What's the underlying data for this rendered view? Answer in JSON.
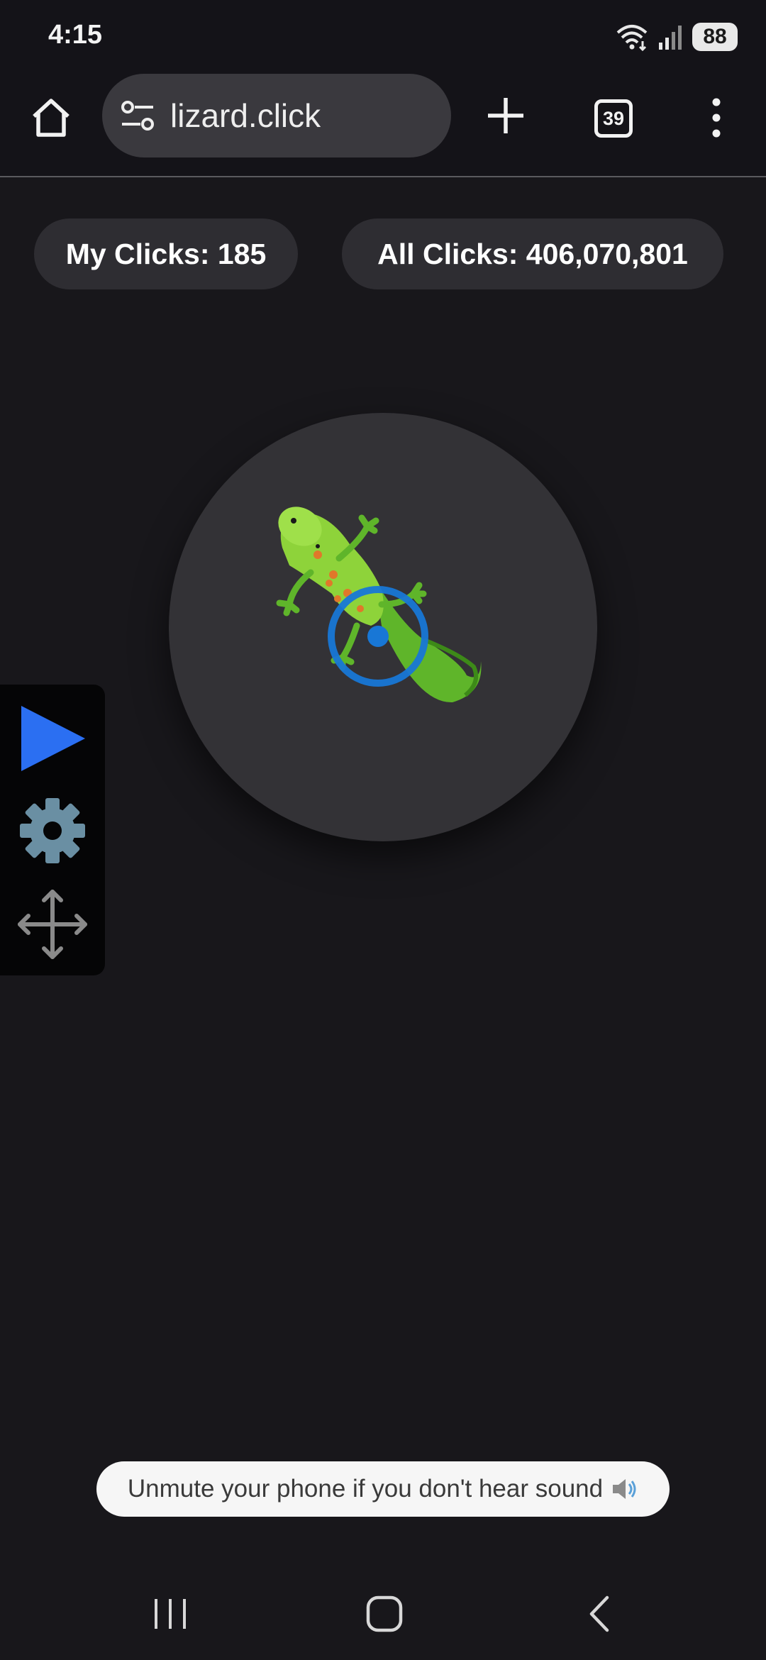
{
  "status_bar": {
    "time": "4:15",
    "battery": "88"
  },
  "browser": {
    "url": "lizard.click",
    "tab_count": "39"
  },
  "counters": {
    "my_clicks": "My Clicks: 185",
    "all_clicks": "All Clicks: 406,070,801"
  },
  "main": {
    "button_icon": "lizard-icon",
    "tap_indicator": "target-ring-icon"
  },
  "side_panel": {
    "items": [
      "play-icon",
      "gear-icon",
      "move-icon"
    ]
  },
  "toast": {
    "message": "Unmute your phone if you don't hear sound",
    "icon": "speaker-icon"
  },
  "colors": {
    "background": "#18171b",
    "pill": "#2e2d32",
    "accent_blue": "#1877d6",
    "play_blue": "#2b6ff2",
    "gear": "#6a8fa3"
  }
}
